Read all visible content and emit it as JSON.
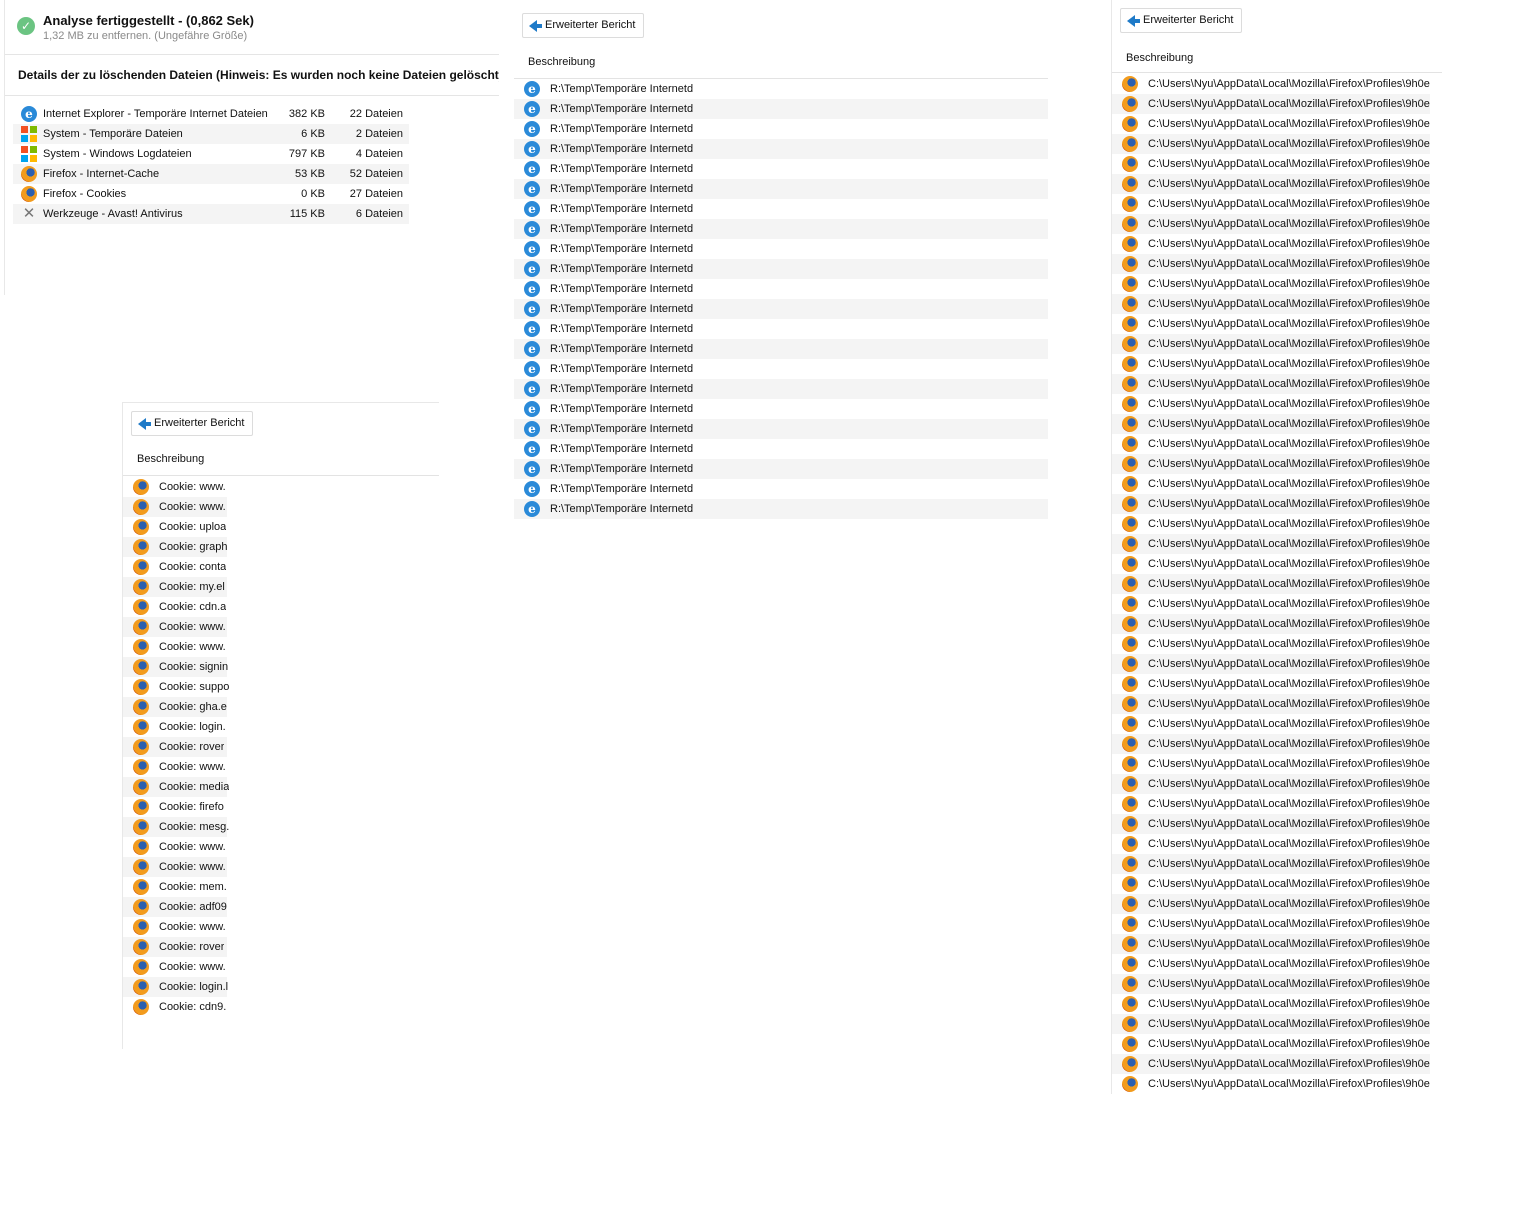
{
  "summary": {
    "title": "Analyse fertiggestellt - (0,862 Sek)",
    "subtitle": "1,32 MB zu entfernen. (Ungefähre Größe)",
    "details_title": "Details der zu löschenden Dateien (Hinweis: Es wurden noch keine Dateien gelöscht)",
    "items": [
      {
        "icon": "ie-icon",
        "name": "Internet Explorer - Temporäre Internet Dateien",
        "size": "382 KB",
        "count": "22 Dateien"
      },
      {
        "icon": "windows-icon",
        "name": "System - Temporäre Dateien",
        "size": "6 KB",
        "count": "2 Dateien"
      },
      {
        "icon": "windows-icon",
        "name": "System - Windows Logdateien",
        "size": "797 KB",
        "count": "4 Dateien"
      },
      {
        "icon": "firefox-icon",
        "name": "Firefox - Internet-Cache",
        "size": "53 KB",
        "count": "52 Dateien"
      },
      {
        "icon": "firefox-icon",
        "name": "Firefox - Cookies",
        "size": "0 KB",
        "count": "27 Dateien"
      },
      {
        "icon": "tools-icon",
        "name": "Werkzeuge - Avast! Antivirus",
        "size": "115 KB",
        "count": "6 Dateien"
      }
    ]
  },
  "ie_report": {
    "back_label": "Erweiterter Bericht",
    "column": "Beschreibung",
    "icon": "ie-icon",
    "rows": [
      "R:\\Temp\\Temporäre Internetd",
      "R:\\Temp\\Temporäre Internetd",
      "R:\\Temp\\Temporäre Internetd",
      "R:\\Temp\\Temporäre Internetd",
      "R:\\Temp\\Temporäre Internetd",
      "R:\\Temp\\Temporäre Internetd",
      "R:\\Temp\\Temporäre Internetd",
      "R:\\Temp\\Temporäre Internetd",
      "R:\\Temp\\Temporäre Internetd",
      "R:\\Temp\\Temporäre Internetd",
      "R:\\Temp\\Temporäre Internetd",
      "R:\\Temp\\Temporäre Internetd",
      "R:\\Temp\\Temporäre Internetd",
      "R:\\Temp\\Temporäre Internetd",
      "R:\\Temp\\Temporäre Internetd",
      "R:\\Temp\\Temporäre Internetd",
      "R:\\Temp\\Temporäre Internetd",
      "R:\\Temp\\Temporäre Internetd",
      "R:\\Temp\\Temporäre Internetd",
      "R:\\Temp\\Temporäre Internetd",
      "R:\\Temp\\Temporäre Internetd",
      "R:\\Temp\\Temporäre Internetd"
    ]
  },
  "cookie_report": {
    "back_label": "Erweiterter Bericht",
    "column": "Beschreibung",
    "icon": "firefox-icon",
    "rows": [
      "Cookie: www.",
      "Cookie: www.",
      "Cookie: uploa",
      "Cookie: graph",
      "Cookie: conta",
      "Cookie: my.el",
      "Cookie: cdn.a",
      "Cookie: www.",
      "Cookie: www.",
      "Cookie: signin",
      "Cookie: suppo",
      "Cookie: gha.e",
      "Cookie: login.",
      "Cookie: rover",
      "Cookie: www.",
      "Cookie: media",
      "Cookie: firefo",
      "Cookie: mesg.",
      "Cookie: www.",
      "Cookie: www.",
      "Cookie: mem.",
      "Cookie: adf09",
      "Cookie: www.",
      "Cookie: rover",
      "Cookie: www.",
      "Cookie: login.l",
      "Cookie: cdn9."
    ]
  },
  "cache_report": {
    "back_label": "Erweiterter Bericht",
    "column": "Beschreibung",
    "icon": "firefox-icon",
    "rows": [
      "C:\\Users\\Nyu\\AppData\\Local\\Mozilla\\Firefox\\Profiles\\9h0e",
      "C:\\Users\\Nyu\\AppData\\Local\\Mozilla\\Firefox\\Profiles\\9h0e",
      "C:\\Users\\Nyu\\AppData\\Local\\Mozilla\\Firefox\\Profiles\\9h0e",
      "C:\\Users\\Nyu\\AppData\\Local\\Mozilla\\Firefox\\Profiles\\9h0e",
      "C:\\Users\\Nyu\\AppData\\Local\\Mozilla\\Firefox\\Profiles\\9h0e",
      "C:\\Users\\Nyu\\AppData\\Local\\Mozilla\\Firefox\\Profiles\\9h0e",
      "C:\\Users\\Nyu\\AppData\\Local\\Mozilla\\Firefox\\Profiles\\9h0e",
      "C:\\Users\\Nyu\\AppData\\Local\\Mozilla\\Firefox\\Profiles\\9h0e",
      "C:\\Users\\Nyu\\AppData\\Local\\Mozilla\\Firefox\\Profiles\\9h0e",
      "C:\\Users\\Nyu\\AppData\\Local\\Mozilla\\Firefox\\Profiles\\9h0e",
      "C:\\Users\\Nyu\\AppData\\Local\\Mozilla\\Firefox\\Profiles\\9h0e",
      "C:\\Users\\Nyu\\AppData\\Local\\Mozilla\\Firefox\\Profiles\\9h0e",
      "C:\\Users\\Nyu\\AppData\\Local\\Mozilla\\Firefox\\Profiles\\9h0e",
      "C:\\Users\\Nyu\\AppData\\Local\\Mozilla\\Firefox\\Profiles\\9h0e",
      "C:\\Users\\Nyu\\AppData\\Local\\Mozilla\\Firefox\\Profiles\\9h0e",
      "C:\\Users\\Nyu\\AppData\\Local\\Mozilla\\Firefox\\Profiles\\9h0e",
      "C:\\Users\\Nyu\\AppData\\Local\\Mozilla\\Firefox\\Profiles\\9h0e",
      "C:\\Users\\Nyu\\AppData\\Local\\Mozilla\\Firefox\\Profiles\\9h0e",
      "C:\\Users\\Nyu\\AppData\\Local\\Mozilla\\Firefox\\Profiles\\9h0e",
      "C:\\Users\\Nyu\\AppData\\Local\\Mozilla\\Firefox\\Profiles\\9h0e",
      "C:\\Users\\Nyu\\AppData\\Local\\Mozilla\\Firefox\\Profiles\\9h0e",
      "C:\\Users\\Nyu\\AppData\\Local\\Mozilla\\Firefox\\Profiles\\9h0e",
      "C:\\Users\\Nyu\\AppData\\Local\\Mozilla\\Firefox\\Profiles\\9h0e",
      "C:\\Users\\Nyu\\AppData\\Local\\Mozilla\\Firefox\\Profiles\\9h0e",
      "C:\\Users\\Nyu\\AppData\\Local\\Mozilla\\Firefox\\Profiles\\9h0e",
      "C:\\Users\\Nyu\\AppData\\Local\\Mozilla\\Firefox\\Profiles\\9h0e",
      "C:\\Users\\Nyu\\AppData\\Local\\Mozilla\\Firefox\\Profiles\\9h0e",
      "C:\\Users\\Nyu\\AppData\\Local\\Mozilla\\Firefox\\Profiles\\9h0e",
      "C:\\Users\\Nyu\\AppData\\Local\\Mozilla\\Firefox\\Profiles\\9h0e",
      "C:\\Users\\Nyu\\AppData\\Local\\Mozilla\\Firefox\\Profiles\\9h0e",
      "C:\\Users\\Nyu\\AppData\\Local\\Mozilla\\Firefox\\Profiles\\9h0e",
      "C:\\Users\\Nyu\\AppData\\Local\\Mozilla\\Firefox\\Profiles\\9h0e",
      "C:\\Users\\Nyu\\AppData\\Local\\Mozilla\\Firefox\\Profiles\\9h0e",
      "C:\\Users\\Nyu\\AppData\\Local\\Mozilla\\Firefox\\Profiles\\9h0e",
      "C:\\Users\\Nyu\\AppData\\Local\\Mozilla\\Firefox\\Profiles\\9h0e",
      "C:\\Users\\Nyu\\AppData\\Local\\Mozilla\\Firefox\\Profiles\\9h0e",
      "C:\\Users\\Nyu\\AppData\\Local\\Mozilla\\Firefox\\Profiles\\9h0e",
      "C:\\Users\\Nyu\\AppData\\Local\\Mozilla\\Firefox\\Profiles\\9h0e",
      "C:\\Users\\Nyu\\AppData\\Local\\Mozilla\\Firefox\\Profiles\\9h0e",
      "C:\\Users\\Nyu\\AppData\\Local\\Mozilla\\Firefox\\Profiles\\9h0e",
      "C:\\Users\\Nyu\\AppData\\Local\\Mozilla\\Firefox\\Profiles\\9h0e",
      "C:\\Users\\Nyu\\AppData\\Local\\Mozilla\\Firefox\\Profiles\\9h0e",
      "C:\\Users\\Nyu\\AppData\\Local\\Mozilla\\Firefox\\Profiles\\9h0e",
      "C:\\Users\\Nyu\\AppData\\Local\\Mozilla\\Firefox\\Profiles\\9h0e",
      "C:\\Users\\Nyu\\AppData\\Local\\Mozilla\\Firefox\\Profiles\\9h0e",
      "C:\\Users\\Nyu\\AppData\\Local\\Mozilla\\Firefox\\Profiles\\9h0e",
      "C:\\Users\\Nyu\\AppData\\Local\\Mozilla\\Firefox\\Profiles\\9h0e",
      "C:\\Users\\Nyu\\AppData\\Local\\Mozilla\\Firefox\\Profiles\\9h0e",
      "C:\\Users\\Nyu\\AppData\\Local\\Mozilla\\Firefox\\Profiles\\9h0e",
      "C:\\Users\\Nyu\\AppData\\Local\\Mozilla\\Firefox\\Profiles\\9h0e",
      "C:\\Users\\Nyu\\AppData\\Local\\Mozilla\\Firefox\\Profiles\\9h0e",
      "C:\\Users\\Nyu\\AppData\\Local\\Mozilla\\Firefox\\Profiles\\9h0e..."
    ]
  }
}
